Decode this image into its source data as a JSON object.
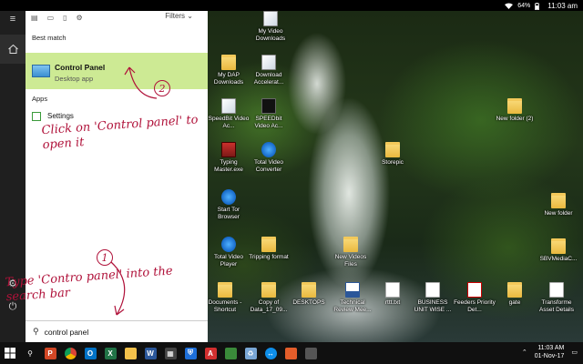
{
  "statusbar": {
    "battery": "64%",
    "time": "11:03 am"
  },
  "start_menu": {
    "filters_label": "Filters",
    "best_match_label": "Best match",
    "best_match": {
      "title": "Control Panel",
      "subtitle": "Desktop app"
    },
    "apps_label": "Apps",
    "apps": [
      {
        "label": "Settings"
      }
    ],
    "search_query": "control panel"
  },
  "annotations": {
    "step1_number": "1",
    "step1_text": "Type 'Contro panel' into the search bar",
    "step2_number": "2",
    "step2_text": "Click on 'Control panel' to open it"
  },
  "desktop_icons": [
    {
      "label": "My Video Downloads",
      "icon": "app-icon"
    },
    {
      "label": "My DAP Downloads",
      "icon": "folder-icon"
    },
    {
      "label": "Download Accelerat...",
      "icon": "app-icon"
    },
    {
      "label": "SpeedBit Video Ac...",
      "icon": "app-icon"
    },
    {
      "label": "SPEEDbit Video Ac...",
      "icon": "app-icon"
    },
    {
      "label": "Typing Master.exe",
      "icon": "typing-icon"
    },
    {
      "label": "Total Video Converter",
      "icon": "app-icon"
    },
    {
      "label": "Start Tor Browser",
      "icon": "tor-icon"
    },
    {
      "label": "Total Video Player",
      "icon": "app-icon"
    },
    {
      "label": "Tripping format",
      "icon": "folder-icon"
    },
    {
      "label": "New Videos Files",
      "icon": "folder-icon"
    },
    {
      "label": "Documents - Shortcut",
      "icon": "folder-icon"
    },
    {
      "label": "Copy of Data_17_09...",
      "icon": "folder-icon"
    },
    {
      "label": "DESKTOPS",
      "icon": "folder-icon"
    },
    {
      "label": "Technical Review Mee...",
      "icon": "word-icon"
    },
    {
      "label": "rttt.txt",
      "icon": "doc-icon"
    },
    {
      "label": "BUSINESS UNIT WISE ...",
      "icon": "doc-icon"
    },
    {
      "label": "Feeders Priority Det...",
      "icon": "pdf-icon"
    },
    {
      "label": "gate",
      "icon": "folder-icon"
    },
    {
      "label": "Transforme Asset Details",
      "icon": "doc-icon"
    },
    {
      "label": "Storepic",
      "icon": "folder-icon"
    },
    {
      "label": "New folder (2)",
      "icon": "folder-icon"
    },
    {
      "label": "New folder",
      "icon": "folder-icon"
    },
    {
      "label": "SBVMediaC...",
      "icon": "folder-icon"
    }
  ],
  "taskbar": {
    "clock_time": "11:03 AM",
    "clock_date": "01-Nov-17",
    "apps": [
      "start-button",
      "search-button",
      "powerpoint-icon",
      "chrome-icon",
      "outlook-icon",
      "excel-icon",
      "folder-icon",
      "word-icon",
      "calculator-icon",
      "defender-icon",
      "adobe-reader-icon",
      "app-icon",
      "recycle-icon",
      "teamviewer-icon",
      "app-icon",
      "app-icon"
    ]
  },
  "colors": {
    "best_match_bg": "#cdea94",
    "annotation_ink": "#b0123a",
    "taskbar_bg": "#101010",
    "rail_bg": "#1f1f1f"
  }
}
